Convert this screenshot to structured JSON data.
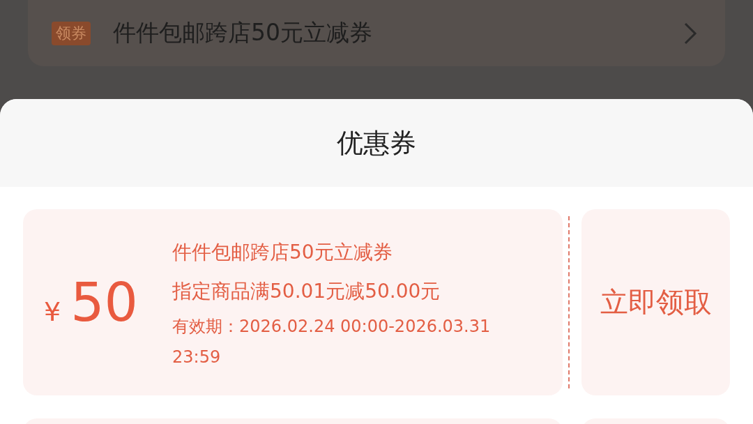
{
  "background_page": {
    "coupon_row": {
      "tag": "领券",
      "label": "件件包邮跨店50元立减券"
    }
  },
  "sheet": {
    "title": "优惠券",
    "coupons": [
      {
        "currency": "¥",
        "amount": "50",
        "name": "件件包邮跨店50元立减券",
        "condition": "指定商品满50.01元减50.00元",
        "validity": "有效期：2026.02.24 00:00-2026.03.31 23:59",
        "action": "立即领取"
      }
    ]
  }
}
